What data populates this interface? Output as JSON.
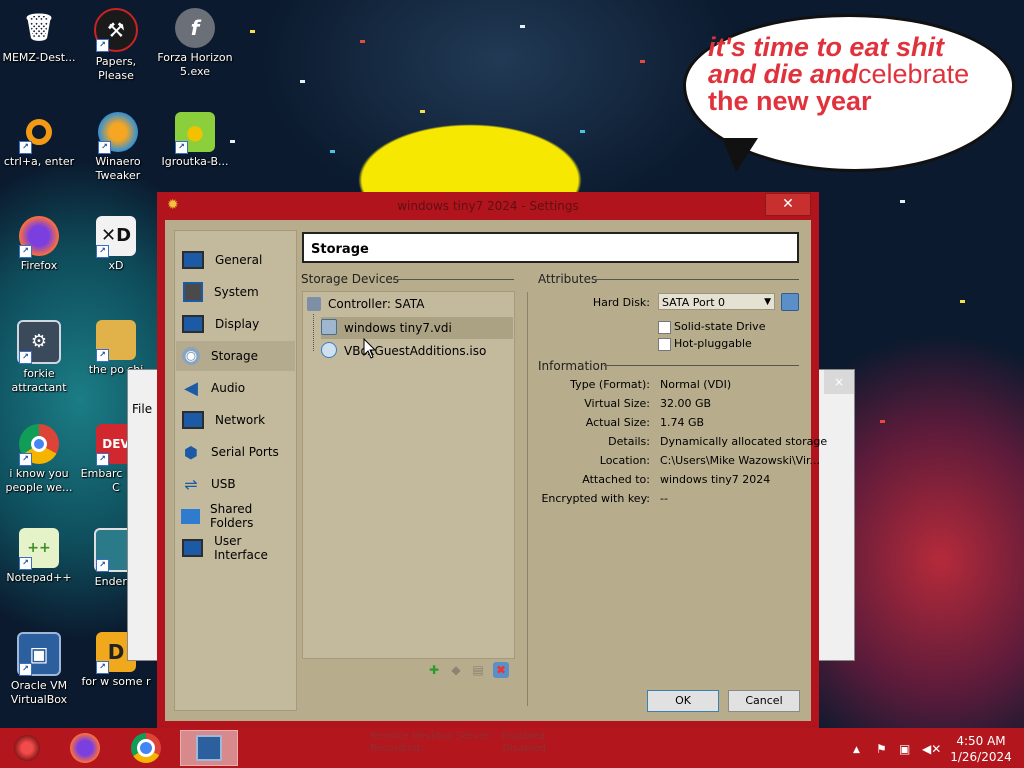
{
  "bubble": {
    "line1": "it's time to eat shit",
    "line2a": "and die and",
    "line2b": "celebrate",
    "line3": "the new year"
  },
  "desktop_icons": [
    {
      "label": "MEMZ-Dest...",
      "icon": "recycle-bin-icon"
    },
    {
      "label": "Papers, Please",
      "icon": "papers-please-icon"
    },
    {
      "label": "Forza Horizon 5.exe",
      "icon": "flash-icon"
    },
    {
      "label": "ctrl+a, enter",
      "icon": "ring-icon"
    },
    {
      "label": "Winaero Tweaker",
      "icon": "winaero-icon"
    },
    {
      "label": "Igroutka-B...",
      "icon": "duck-icon"
    },
    {
      "label": "Firefox",
      "icon": "firefox-icon"
    },
    {
      "label": "xD",
      "icon": "xd-icon"
    },
    {
      "label": "forkie attractant",
      "icon": "settings-monitor-icon"
    },
    {
      "label": "the po shi",
      "icon": "folder-icon"
    },
    {
      "label": "i know you people we...",
      "icon": "chrome-icon"
    },
    {
      "label": "Embarc Dev-C",
      "icon": "devc-icon"
    },
    {
      "label": "Notepad++",
      "icon": "notepadpp-icon"
    },
    {
      "label": "Enderm",
      "icon": "enderman-icon"
    },
    {
      "label": "Oracle VM VirtualBox",
      "icon": "virtualbox-icon"
    },
    {
      "label": "for w some r",
      "icon": "pdf-icon"
    }
  ],
  "background_window": {
    "menu_file": "File",
    "close": "×"
  },
  "dialog": {
    "title": "windows tiny7 2024 - Settings",
    "close_symbol": "✕",
    "nav": [
      {
        "label": "General",
        "icon": "general-icon"
      },
      {
        "label": "System",
        "icon": "system-icon"
      },
      {
        "label": "Display",
        "icon": "display-icon"
      },
      {
        "label": "Storage",
        "icon": "storage-icon",
        "selected": true
      },
      {
        "label": "Audio",
        "icon": "audio-icon"
      },
      {
        "label": "Network",
        "icon": "network-icon"
      },
      {
        "label": "Serial Ports",
        "icon": "serial-ports-icon"
      },
      {
        "label": "USB",
        "icon": "usb-icon"
      },
      {
        "label": "Shared Folders",
        "icon": "shared-folders-icon"
      },
      {
        "label": "User Interface",
        "icon": "user-interface-icon"
      }
    ],
    "page_title": "Storage",
    "storage_devices_header": "Storage Devices",
    "tree": {
      "controller": "Controller: SATA",
      "items": [
        {
          "label": "windows tiny7.vdi",
          "icon": "hard-disk-icon",
          "selected": true
        },
        {
          "label": "VBoxGuestAdditions.iso",
          "icon": "optical-disc-icon"
        }
      ]
    },
    "attributes_header": "Attributes",
    "hard_disk_label": "Hard Disk:",
    "hard_disk_value": "SATA Port 0",
    "solid_state_label": "Solid-state Drive",
    "solid_state_checked": false,
    "hot_pluggable_label": "Hot-pluggable",
    "hot_pluggable_checked": false,
    "information_header": "Information",
    "info": [
      {
        "label": "Type (Format):",
        "value": "Normal (VDI)"
      },
      {
        "label": "Virtual Size:",
        "value": "32.00 GB"
      },
      {
        "label": "Actual Size:",
        "value": "1.74 GB"
      },
      {
        "label": "Details:",
        "value": "Dynamically allocated storage"
      },
      {
        "label": "Location:",
        "value": "C:\\Users\\Mike Wazowski\\Vir..."
      },
      {
        "label": "Attached to:",
        "value": "windows tiny7 2024"
      },
      {
        "label": "Encrypted with key:",
        "value": "--"
      }
    ],
    "ok_label": "OK",
    "cancel_label": "Cancel"
  },
  "taskbar": {
    "notice_line1": "Remote Desktop Server:",
    "notice_line1_value": "Disabled",
    "notice_line2": "Recording:",
    "notice_line2_value": "Disabled",
    "time": "4:50 AM",
    "date": "1/26/2024"
  },
  "colors": {
    "window_frame": "#b1141c",
    "client_bg": "#b7ac8c",
    "taskbar": "#b3161c",
    "bubble_text": "#e0323c"
  }
}
